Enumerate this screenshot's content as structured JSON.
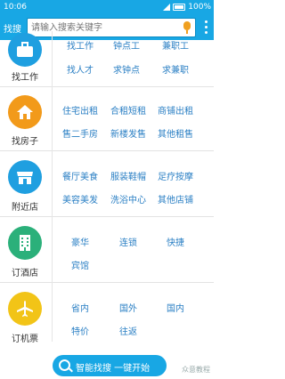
{
  "status_bar": {
    "time": "10:06",
    "battery": "100%"
  },
  "header": {
    "logo": "找搜",
    "search_placeholder": "请输入搜索关键字"
  },
  "sections": [
    {
      "label": "找工作",
      "icon": "briefcase-icon",
      "color": "#1f9fe0",
      "items": [
        "找工作",
        "钟点工",
        "兼职工",
        "找人才",
        "求钟点",
        "求兼职"
      ]
    },
    {
      "label": "找房子",
      "icon": "house-icon",
      "color": "#f29a1a",
      "items": [
        "住宅出租",
        "合租短租",
        "商铺出租",
        "售二手房",
        "新楼发售",
        "其他租售"
      ]
    },
    {
      "label": "附近店",
      "icon": "store-icon",
      "color": "#1f9fe0",
      "items": [
        "餐厅美食",
        "服装鞋帽",
        "足疗按摩",
        "美容美发",
        "洗浴中心",
        "其他店铺"
      ]
    },
    {
      "label": "订酒店",
      "icon": "hotel-icon",
      "color": "#2bb07a",
      "items": [
        "豪华",
        "连锁",
        "快捷",
        "宾馆"
      ]
    },
    {
      "label": "订机票",
      "icon": "plane-icon",
      "color": "#f2c417",
      "items": [
        "省内",
        "国外",
        "国内",
        "特价",
        "往返"
      ]
    }
  ],
  "cta": {
    "label": "智能找搜  一键开始"
  },
  "watermark": "众意教程"
}
